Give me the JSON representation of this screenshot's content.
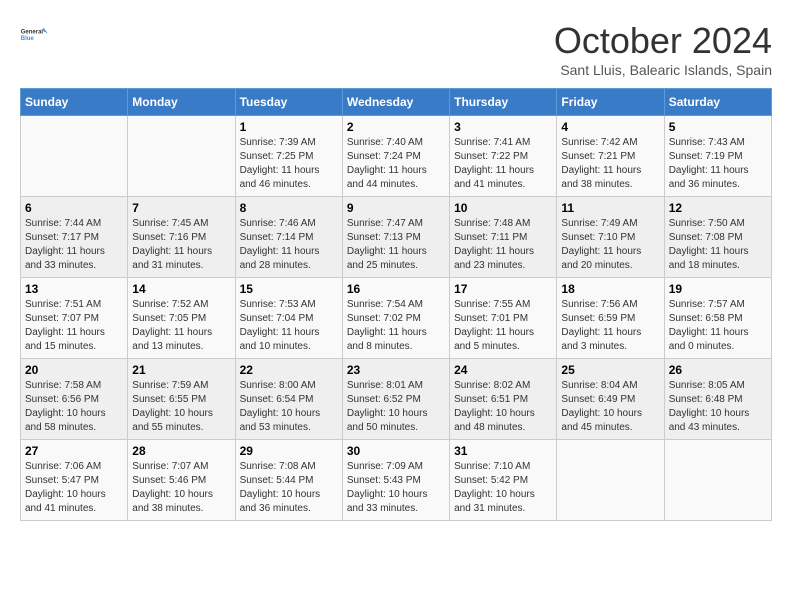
{
  "logo": {
    "line1": "General",
    "line2": "Blue"
  },
  "title": "October 2024",
  "subtitle": "Sant Lluis, Balearic Islands, Spain",
  "days_of_week": [
    "Sunday",
    "Monday",
    "Tuesday",
    "Wednesday",
    "Thursday",
    "Friday",
    "Saturday"
  ],
  "weeks": [
    [
      {
        "day": "",
        "sunrise": "",
        "sunset": "",
        "daylight": ""
      },
      {
        "day": "",
        "sunrise": "",
        "sunset": "",
        "daylight": ""
      },
      {
        "day": "1",
        "sunrise": "Sunrise: 7:39 AM",
        "sunset": "Sunset: 7:25 PM",
        "daylight": "Daylight: 11 hours and 46 minutes."
      },
      {
        "day": "2",
        "sunrise": "Sunrise: 7:40 AM",
        "sunset": "Sunset: 7:24 PM",
        "daylight": "Daylight: 11 hours and 44 minutes."
      },
      {
        "day": "3",
        "sunrise": "Sunrise: 7:41 AM",
        "sunset": "Sunset: 7:22 PM",
        "daylight": "Daylight: 11 hours and 41 minutes."
      },
      {
        "day": "4",
        "sunrise": "Sunrise: 7:42 AM",
        "sunset": "Sunset: 7:21 PM",
        "daylight": "Daylight: 11 hours and 38 minutes."
      },
      {
        "day": "5",
        "sunrise": "Sunrise: 7:43 AM",
        "sunset": "Sunset: 7:19 PM",
        "daylight": "Daylight: 11 hours and 36 minutes."
      }
    ],
    [
      {
        "day": "6",
        "sunrise": "Sunrise: 7:44 AM",
        "sunset": "Sunset: 7:17 PM",
        "daylight": "Daylight: 11 hours and 33 minutes."
      },
      {
        "day": "7",
        "sunrise": "Sunrise: 7:45 AM",
        "sunset": "Sunset: 7:16 PM",
        "daylight": "Daylight: 11 hours and 31 minutes."
      },
      {
        "day": "8",
        "sunrise": "Sunrise: 7:46 AM",
        "sunset": "Sunset: 7:14 PM",
        "daylight": "Daylight: 11 hours and 28 minutes."
      },
      {
        "day": "9",
        "sunrise": "Sunrise: 7:47 AM",
        "sunset": "Sunset: 7:13 PM",
        "daylight": "Daylight: 11 hours and 25 minutes."
      },
      {
        "day": "10",
        "sunrise": "Sunrise: 7:48 AM",
        "sunset": "Sunset: 7:11 PM",
        "daylight": "Daylight: 11 hours and 23 minutes."
      },
      {
        "day": "11",
        "sunrise": "Sunrise: 7:49 AM",
        "sunset": "Sunset: 7:10 PM",
        "daylight": "Daylight: 11 hours and 20 minutes."
      },
      {
        "day": "12",
        "sunrise": "Sunrise: 7:50 AM",
        "sunset": "Sunset: 7:08 PM",
        "daylight": "Daylight: 11 hours and 18 minutes."
      }
    ],
    [
      {
        "day": "13",
        "sunrise": "Sunrise: 7:51 AM",
        "sunset": "Sunset: 7:07 PM",
        "daylight": "Daylight: 11 hours and 15 minutes."
      },
      {
        "day": "14",
        "sunrise": "Sunrise: 7:52 AM",
        "sunset": "Sunset: 7:05 PM",
        "daylight": "Daylight: 11 hours and 13 minutes."
      },
      {
        "day": "15",
        "sunrise": "Sunrise: 7:53 AM",
        "sunset": "Sunset: 7:04 PM",
        "daylight": "Daylight: 11 hours and 10 minutes."
      },
      {
        "day": "16",
        "sunrise": "Sunrise: 7:54 AM",
        "sunset": "Sunset: 7:02 PM",
        "daylight": "Daylight: 11 hours and 8 minutes."
      },
      {
        "day": "17",
        "sunrise": "Sunrise: 7:55 AM",
        "sunset": "Sunset: 7:01 PM",
        "daylight": "Daylight: 11 hours and 5 minutes."
      },
      {
        "day": "18",
        "sunrise": "Sunrise: 7:56 AM",
        "sunset": "Sunset: 6:59 PM",
        "daylight": "Daylight: 11 hours and 3 minutes."
      },
      {
        "day": "19",
        "sunrise": "Sunrise: 7:57 AM",
        "sunset": "Sunset: 6:58 PM",
        "daylight": "Daylight: 11 hours and 0 minutes."
      }
    ],
    [
      {
        "day": "20",
        "sunrise": "Sunrise: 7:58 AM",
        "sunset": "Sunset: 6:56 PM",
        "daylight": "Daylight: 10 hours and 58 minutes."
      },
      {
        "day": "21",
        "sunrise": "Sunrise: 7:59 AM",
        "sunset": "Sunset: 6:55 PM",
        "daylight": "Daylight: 10 hours and 55 minutes."
      },
      {
        "day": "22",
        "sunrise": "Sunrise: 8:00 AM",
        "sunset": "Sunset: 6:54 PM",
        "daylight": "Daylight: 10 hours and 53 minutes."
      },
      {
        "day": "23",
        "sunrise": "Sunrise: 8:01 AM",
        "sunset": "Sunset: 6:52 PM",
        "daylight": "Daylight: 10 hours and 50 minutes."
      },
      {
        "day": "24",
        "sunrise": "Sunrise: 8:02 AM",
        "sunset": "Sunset: 6:51 PM",
        "daylight": "Daylight: 10 hours and 48 minutes."
      },
      {
        "day": "25",
        "sunrise": "Sunrise: 8:04 AM",
        "sunset": "Sunset: 6:49 PM",
        "daylight": "Daylight: 10 hours and 45 minutes."
      },
      {
        "day": "26",
        "sunrise": "Sunrise: 8:05 AM",
        "sunset": "Sunset: 6:48 PM",
        "daylight": "Daylight: 10 hours and 43 minutes."
      }
    ],
    [
      {
        "day": "27",
        "sunrise": "Sunrise: 7:06 AM",
        "sunset": "Sunset: 5:47 PM",
        "daylight": "Daylight: 10 hours and 41 minutes."
      },
      {
        "day": "28",
        "sunrise": "Sunrise: 7:07 AM",
        "sunset": "Sunset: 5:46 PM",
        "daylight": "Daylight: 10 hours and 38 minutes."
      },
      {
        "day": "29",
        "sunrise": "Sunrise: 7:08 AM",
        "sunset": "Sunset: 5:44 PM",
        "daylight": "Daylight: 10 hours and 36 minutes."
      },
      {
        "day": "30",
        "sunrise": "Sunrise: 7:09 AM",
        "sunset": "Sunset: 5:43 PM",
        "daylight": "Daylight: 10 hours and 33 minutes."
      },
      {
        "day": "31",
        "sunrise": "Sunrise: 7:10 AM",
        "sunset": "Sunset: 5:42 PM",
        "daylight": "Daylight: 10 hours and 31 minutes."
      },
      {
        "day": "",
        "sunrise": "",
        "sunset": "",
        "daylight": ""
      },
      {
        "day": "",
        "sunrise": "",
        "sunset": "",
        "daylight": ""
      }
    ]
  ]
}
